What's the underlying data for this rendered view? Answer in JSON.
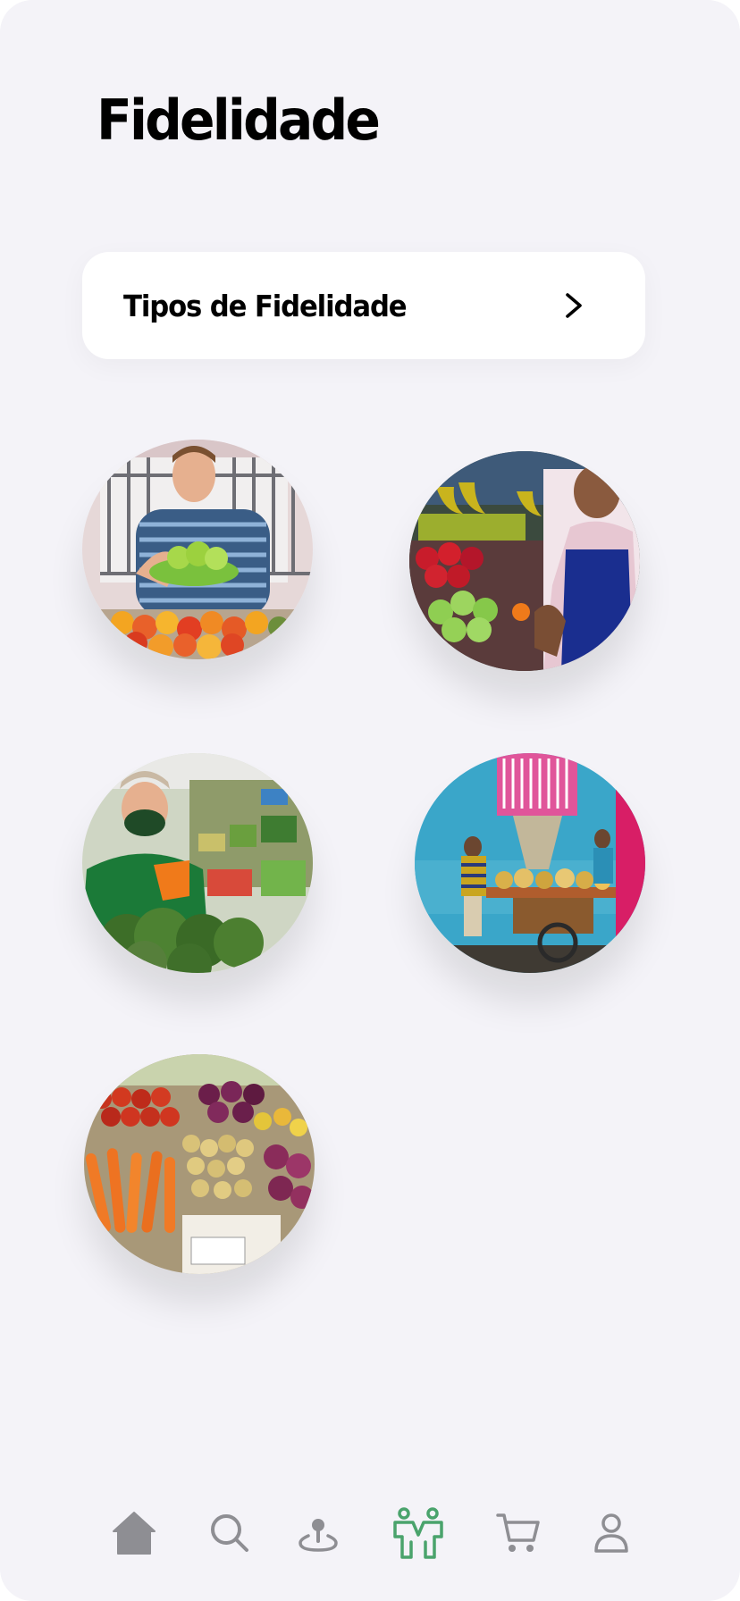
{
  "header": {
    "title": "Fidelidade"
  },
  "loyalty_types_card": {
    "label": "Tipos de Fidelidade",
    "icon": "chevron-right-icon"
  },
  "vendors": [
    {
      "name": "vendor-photo-1",
      "scene": "smiling man holding a bowl of green fruit over a tomato stall"
    },
    {
      "name": "vendor-photo-2",
      "scene": "woman in blue apron beside apples and bananas"
    },
    {
      "name": "vendor-photo-3",
      "scene": "man in green shirt and face mask behind broccoli"
    },
    {
      "name": "vendor-photo-4",
      "scene": "street vendor pushing a fruit cart by a blue wall"
    },
    {
      "name": "vendor-photo-5",
      "scene": "market crates of carrots, potatoes, tomatoes and onions"
    }
  ],
  "bottom_nav": {
    "items": [
      {
        "id": "home",
        "icon": "home-icon",
        "active": false
      },
      {
        "id": "search",
        "icon": "search-icon",
        "active": false
      },
      {
        "id": "location",
        "icon": "location-pin-icon",
        "active": false
      },
      {
        "id": "loyalty",
        "icon": "people-icon",
        "active": true
      },
      {
        "id": "cart",
        "icon": "cart-icon",
        "active": false
      },
      {
        "id": "profile",
        "icon": "user-icon",
        "active": false
      }
    ],
    "active_color": "#4aa36c",
    "inactive_color": "#8e8e93"
  },
  "colors": {
    "background": "#f4f3f8",
    "card": "#ffffff",
    "text": "#000000"
  }
}
